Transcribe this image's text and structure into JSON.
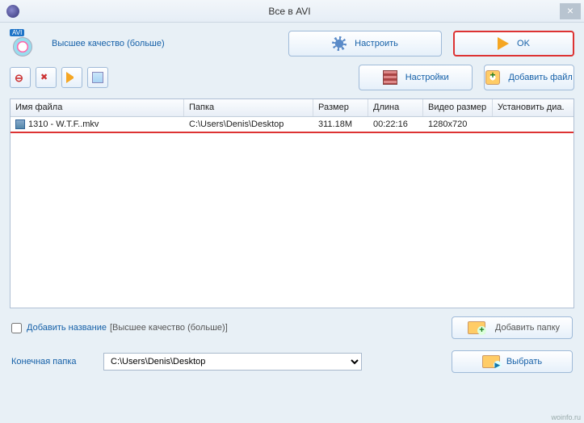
{
  "title": "Все в AVI",
  "quality_label": "Высшее качество (больше)",
  "format_badge": "AVI",
  "buttons": {
    "configure": "Настроить",
    "ok": "OK",
    "settings": "Настройки",
    "add_file": "Добавить файл",
    "add_folder": "Добавить папку",
    "choose": "Выбрать"
  },
  "table": {
    "headers": [
      "Имя файла",
      "Папка",
      "Размер",
      "Длина",
      "Видео размер",
      "Установить диа."
    ],
    "rows": [
      {
        "name": "1310 - W.T.F..mkv",
        "folder": "C:\\Users\\Denis\\Desktop",
        "size": "311.18M",
        "length": "00:22:16",
        "vsize": "1280x720",
        "dia": ""
      }
    ]
  },
  "checkbox": {
    "label": "Добавить название",
    "suffix": "[Высшее качество (больше)]"
  },
  "dest": {
    "label": "Конечная папка",
    "value": "C:\\Users\\Denis\\Desktop"
  },
  "watermark": "woinfo.ru"
}
